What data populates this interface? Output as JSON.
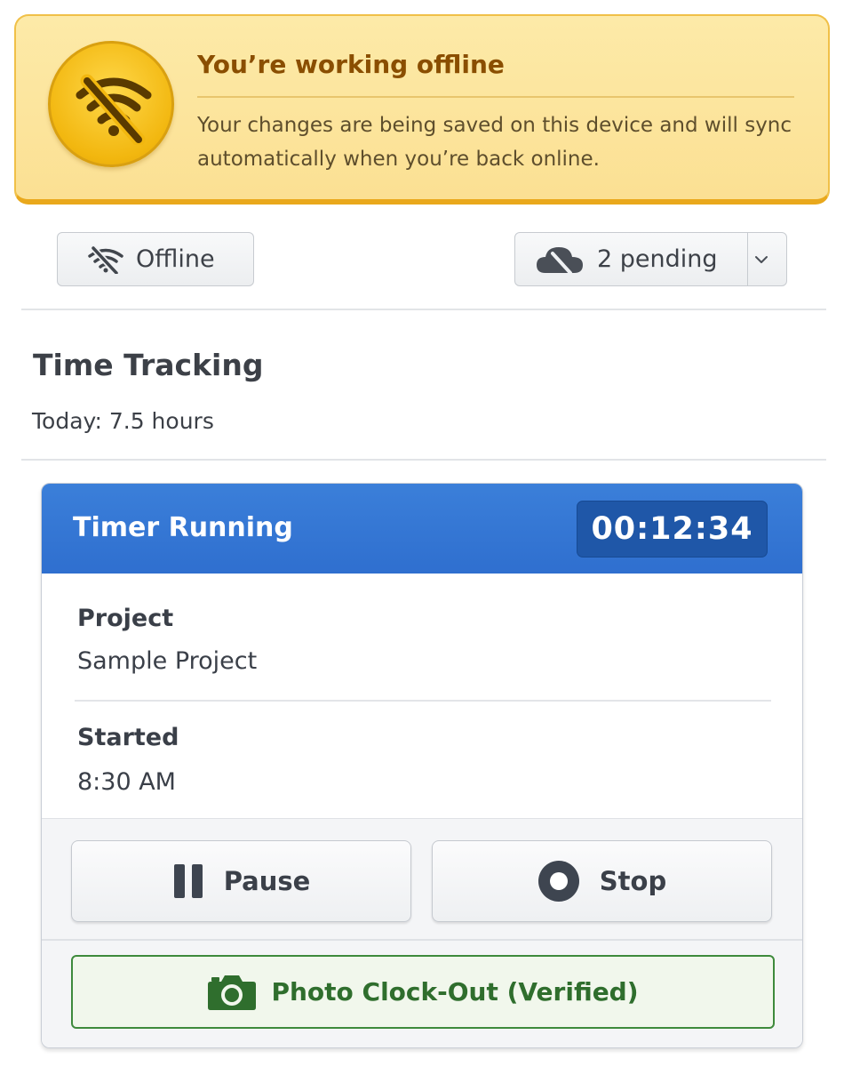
{
  "banner": {
    "title": "You’re working offline",
    "message": "Your changes are being saved on this device and will sync automatically when you’re back online.",
    "icon": "wifi-off-icon",
    "accent": "#f2b70f"
  },
  "status": {
    "offline_label": "Offline",
    "pending_label": "2 pending",
    "icons": [
      "wifi-off-icon",
      "cloud-off-icon",
      "chevron-down-icon"
    ]
  },
  "page": {
    "title": "Time Tracking",
    "today": "Today: 7.5 hours"
  },
  "timer": {
    "title": "Timer Running",
    "elapsed": "00:12:34",
    "header_color": "#3178d4",
    "fields": [
      {
        "label": "Project",
        "value": "Sample Project"
      },
      {
        "label": "Started",
        "value": "8:30 AM"
      }
    ],
    "actions": {
      "pause_label": "Pause",
      "stop_label": "Stop",
      "photo_label": "Photo Clock-Out (Verified)",
      "photo_color": "#2f6e2d"
    }
  }
}
